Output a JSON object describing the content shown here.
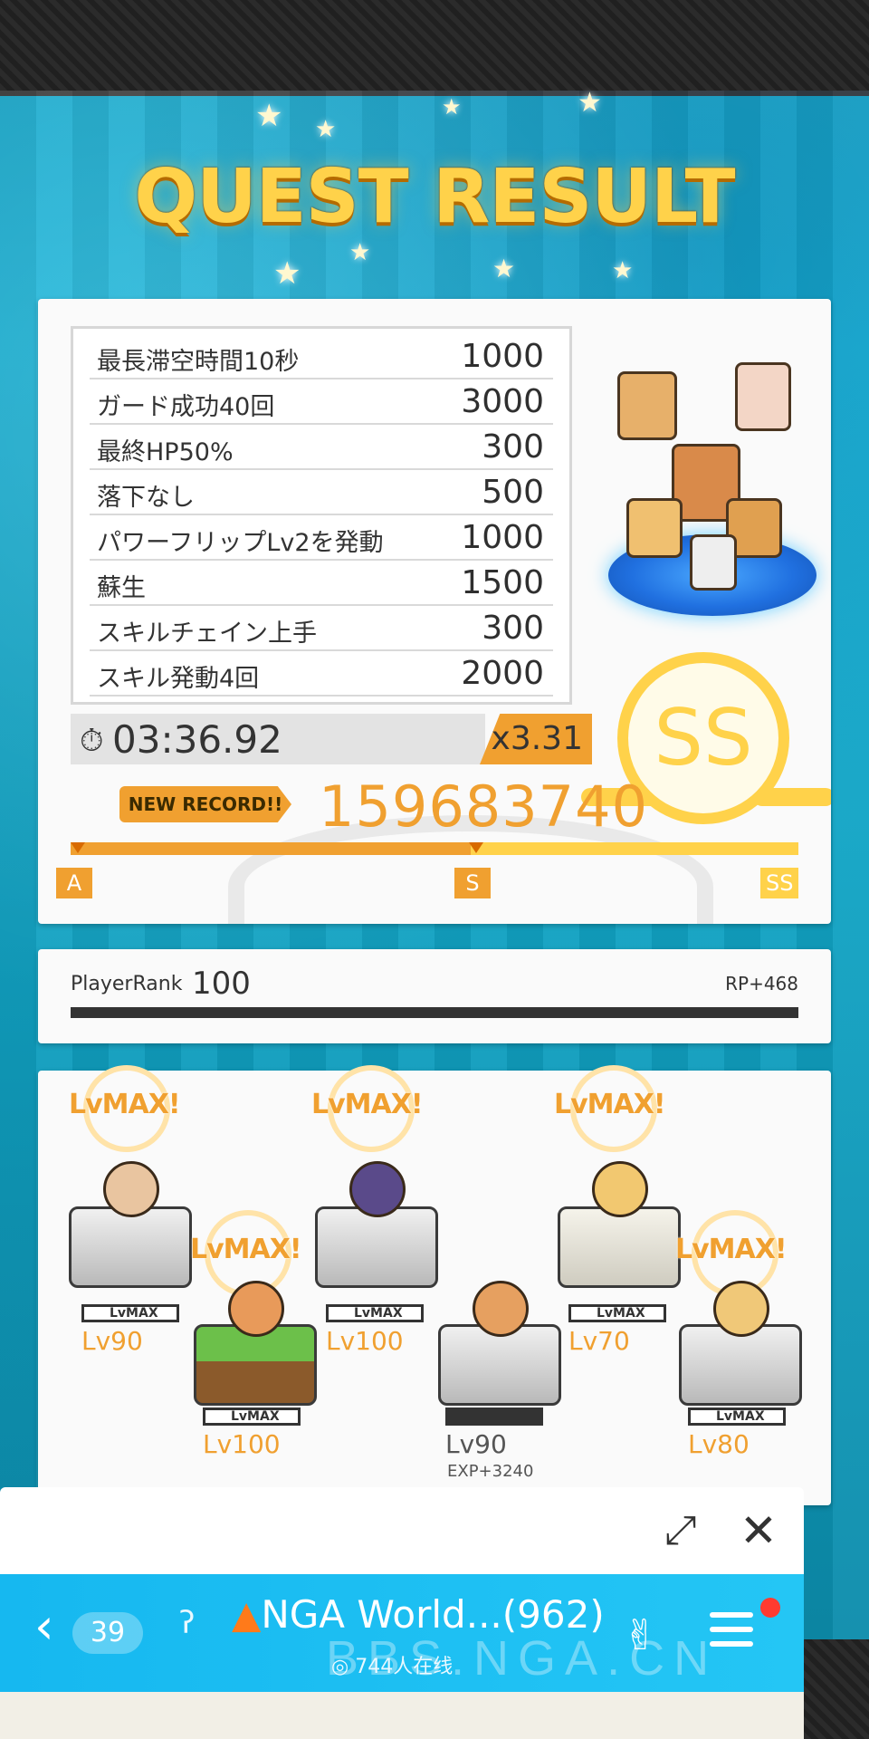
{
  "title": "QUEST RESULT",
  "bonuses": [
    {
      "label": "最長滞空時間10秒",
      "value": "1000"
    },
    {
      "label": "ガード成功40回",
      "value": "3000"
    },
    {
      "label": "最終HP50%",
      "value": "300"
    },
    {
      "label": "落下なし",
      "value": "500"
    },
    {
      "label": "パワーフリップLv2を発動",
      "value": "1000"
    },
    {
      "label": "蘇生",
      "value": "1500"
    },
    {
      "label": "スキルチェイン上手",
      "value": "300"
    },
    {
      "label": "スキル発動4回",
      "value": "2000"
    }
  ],
  "time": "03:36.92",
  "multiplier": "x3.31",
  "new_record": "NEW RECORD!!",
  "score": "159683740",
  "rank_grade": "SS",
  "rank_progress": 1.0,
  "rank_marks": {
    "a": "A",
    "s": "S",
    "ss": "SS"
  },
  "player_rank": {
    "label": "PlayerRank",
    "value": "100",
    "rp": "RP+468",
    "progress": 1.0
  },
  "characters": [
    {
      "lvmax": "LvMAX!",
      "bar": "LvMAX",
      "level": "Lv90"
    },
    {
      "lvmax": "LvMAX!",
      "bar": "LvMAX",
      "level": "Lv100"
    },
    {
      "lvmax": "LvMAX!",
      "bar": "LvMAX",
      "level": "Lv100"
    },
    {
      "lvmax": "",
      "bar": "",
      "level": "Lv90",
      "exp": "EXP+3240"
    },
    {
      "lvmax": "LvMAX!",
      "bar": "LvMAX",
      "level": "Lv70"
    },
    {
      "lvmax": "LvMAX!",
      "bar": "LvMAX",
      "level": "Lv80"
    }
  ],
  "chat": {
    "back_count": "39",
    "room_title": "NGA World...(962)",
    "online": "744人在线",
    "watermark": "BBS.NGA.CN"
  },
  "colors": {
    "accent": "#f0a030",
    "gold": "#ffd24a",
    "chat_blue": "#16b8f0"
  },
  "icons": [
    "clock-icon",
    "expand-icon",
    "close-icon",
    "back-arrow-icon",
    "ear-icon",
    "fire-icon",
    "rock-hand-icon",
    "menu-icon"
  ]
}
